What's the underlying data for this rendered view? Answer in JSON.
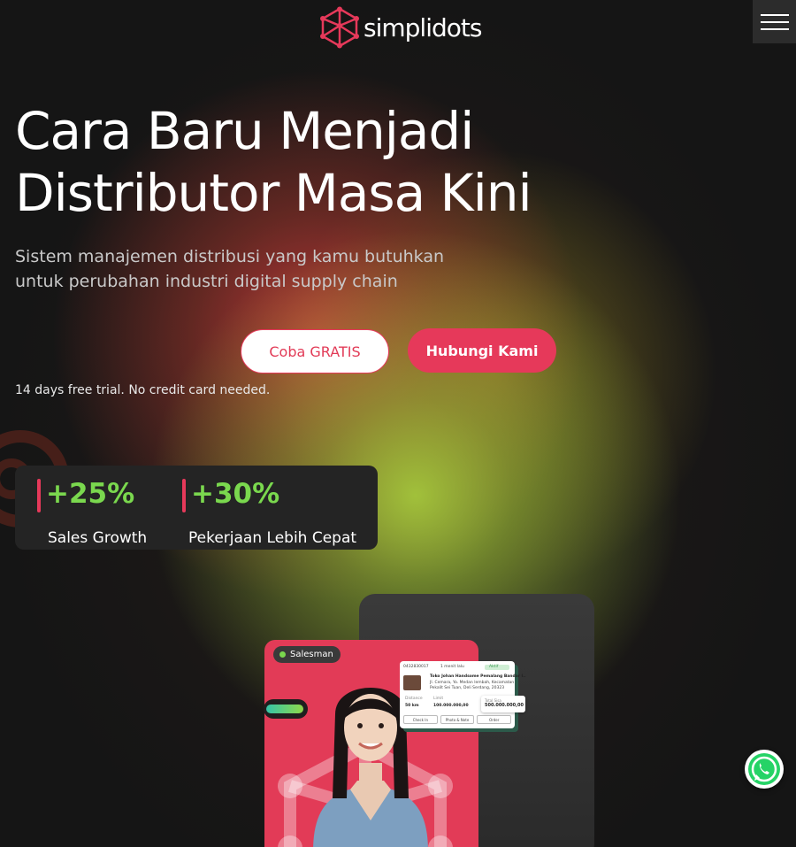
{
  "header": {
    "logo_text": "simplidots",
    "menu_icon": "hamburger-icon"
  },
  "hero": {
    "title_line1": "Cara Baru Menjadi",
    "title_line2": "Distributor Masa Kini",
    "subtitle_line1": "Sistem manajemen distribusi yang kamu butuhkan",
    "subtitle_line2": "untuk perubahan industri digital supply chain",
    "try_button": "Coba GRATIS",
    "contact_button": "Hubungi Kami",
    "trial_note": "14 days free trial. No credit card needed."
  },
  "stats": [
    {
      "value": "+25%",
      "label": "Sales Growth"
    },
    {
      "value": "+30%",
      "label": "Pekerjaan Lebih Cepat"
    }
  ],
  "illustration": {
    "badge": "Salesman",
    "card": {
      "id": "0432830017",
      "time": "1 menit lalu",
      "status": "Aktif",
      "store": "Toko Johan Handsome Pemalang Bandar I..",
      "address1": "Jl. Cemara, Yo. Medan lembah, Kecamatan",
      "address2": "Pekalit Sei Tuan, Deli Serdang, 20323",
      "distance_label": "Distance",
      "distance": "50 km",
      "limit_label": "Limit",
      "limit": "100.000.000,00",
      "total_label": "Total Sisa",
      "total": "500.000.000,00",
      "btn_checkin": "Check In",
      "btn_photo": "Photo & Note",
      "btn_order": "Order"
    }
  },
  "colors": {
    "accent": "#e6395a",
    "stat_green": "#7ad84e",
    "background": "#151515"
  },
  "floating": {
    "whatsapp_icon": "whatsapp-icon"
  }
}
